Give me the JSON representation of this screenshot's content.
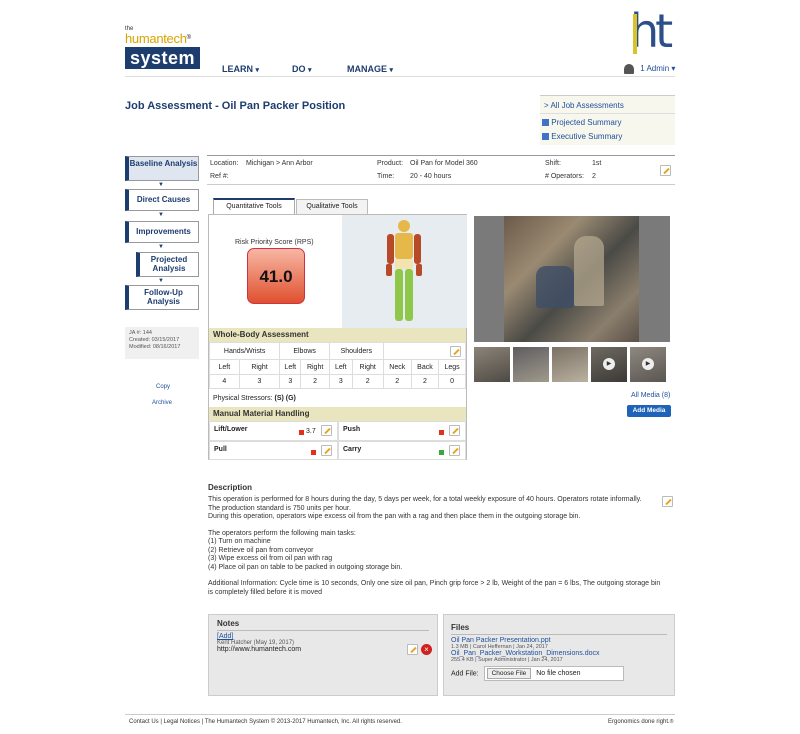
{
  "brand": {
    "the": "the",
    "humantech": "humantech",
    "reg": "®",
    "system": "system",
    "logo_right": "ht"
  },
  "nav": {
    "learn": "LEARN",
    "do": "DO",
    "manage": "MANAGE"
  },
  "user": {
    "label": "1 Admin"
  },
  "page": {
    "title": "Job Assessment - Oil Pan Packer Position"
  },
  "quick_links": {
    "all": "All Job Assessments",
    "projected": "Projected Summary",
    "executive": "Executive Summary"
  },
  "steps": {
    "baseline": "Baseline Analysis",
    "direct": "Direct Causes",
    "improvements": "Improvements",
    "projected": "Projected Analysis",
    "followup": "Follow-Up Analysis"
  },
  "meta": {
    "ja": "JA #: 144",
    "created": "Created: 03/15/2017",
    "modified": "Modified: 08/16/2017"
  },
  "side_links": {
    "copy": "Copy",
    "archive": "Archive"
  },
  "info": {
    "location_label": "Location:",
    "location": "Michigan > Ann Arbor",
    "product_label": "Product:",
    "product": "Oil Pan for Model 360",
    "shift_label": "Shift:",
    "shift": "1st",
    "ref_label": "Ref #:",
    "ref": "",
    "time_label": "Time:",
    "time": "20 - 40 hours",
    "operators_label": "# Operators:",
    "operators": "2"
  },
  "tabs": {
    "quant": "Quantitative Tools",
    "qual": "Qualitative Tools"
  },
  "rps": {
    "label": "Risk Priority Score (RPS)",
    "value": "41.0"
  },
  "colors": {
    "rps_red": "#e0502f",
    "body_high": "#b84a2a",
    "body_med": "#e6b84a",
    "body_low": "#8fc74a",
    "media_btn": "#1f63b8"
  },
  "wba": {
    "title": "Whole-Body Assessment",
    "groups": [
      "Hands/Wrists",
      "Elbows",
      "Shoulders"
    ],
    "sub": [
      "Left",
      "Right",
      "Left",
      "Right",
      "Left",
      "Right",
      "Neck",
      "Back",
      "Legs"
    ],
    "vals": [
      "4",
      "3",
      "3",
      "2",
      "3",
      "2",
      "2",
      "2",
      "0"
    ],
    "stressors_label": "Physical Stressors:",
    "stressors": "(S) (G)"
  },
  "mmh": {
    "title": "Manual Material Handling",
    "lift": "Lift/Lower",
    "lift_val": "3.7",
    "push": "Push",
    "pull": "Pull",
    "carry": "Carry"
  },
  "media": {
    "all": "All Media (8)",
    "add": "Add Media"
  },
  "description": {
    "title": "Description",
    "p1": "This operation is performed for 8 hours during the day, 5 days per week, for a total weekly exposure of 40 hours.  Operators rotate informally.",
    "p2": "The production standard is 750 units per hour.",
    "p3": "During this operation, operators wipe excess oil from the pan with a rag and then place them in the outgoing storage bin.",
    "p4": "The operators perform the following main tasks:",
    "t1": "(1) Turn on machine",
    "t2": "(2) Retrieve oil pan from conveyor",
    "t3": "(3) Wipe excess oil from oil pan with rag",
    "t4": "(4) Place oil pan on table to be packed in outgoing storage bin.",
    "add1": "Additional Information: Cycle time is 10 seconds, Only one size oil pan, Pinch grip force > 2 lb, Weight of the pan = 6 lbs, The outgoing storage bin",
    "add2": "is completely filled before it is moved"
  },
  "notes": {
    "title": "Notes",
    "add": "[Add]",
    "author": "Kent Hatcher (May 19, 2017)",
    "text": "http://www.humantech.com"
  },
  "files": {
    "title": "Files",
    "f1": "Oil Pan Packer Presentation.ppt",
    "f1_meta": "1.3 MB | Carol Heffernan | Jan 24, 2017",
    "f2": "Oil_Pan_Packer_Workstation_Dimensions.docx",
    "f2_meta": "255.4 KB | Super Administrator | Jan 24, 2017",
    "add_label": "Add File:",
    "choose": "Choose File",
    "none": "No file chosen"
  },
  "footer": {
    "contact": "Contact Us",
    "legal": "Legal Notices",
    "copy": "The Humantech System © 2013-2017 Humantech, Inc. All rights reserved.",
    "tagline": "Ergonomics done right.",
    "reg": "®"
  }
}
